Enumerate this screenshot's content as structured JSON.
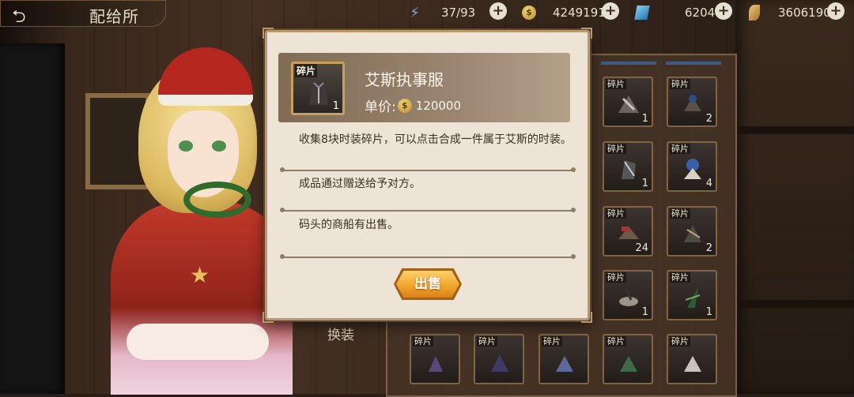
{
  "header": {
    "title": "配给所"
  },
  "resources": {
    "energy": "37/93",
    "gold": "4249191",
    "gems": "6204",
    "material": "3606190"
  },
  "dialog": {
    "item_tag": "碎片",
    "item_qty": "1",
    "item_name": "艾斯执事服",
    "price_label": "单价:",
    "price_value": "120000",
    "desc1": "收集8块时装碎片，可以点击合成一件属于艾斯的时装。",
    "desc2": "成品通过赠送给予对方。",
    "desc3": "码头的商船有出售。",
    "sell_label": "出售"
  },
  "inventory": {
    "swap_label": "换装",
    "slot_tag": "碎片",
    "right_slots": [
      {
        "qty": "1"
      },
      {
        "qty": "2"
      },
      {
        "qty": "1"
      },
      {
        "qty": "4"
      },
      {
        "qty": "24"
      },
      {
        "qty": "2"
      },
      {
        "qty": "1"
      },
      {
        "qty": "1"
      }
    ]
  }
}
